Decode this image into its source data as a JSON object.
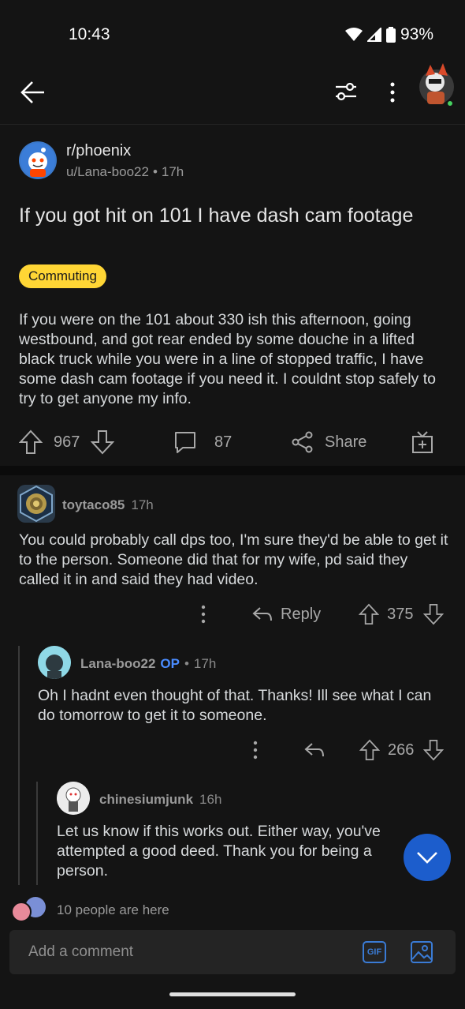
{
  "status_bar": {
    "time": "10:43",
    "battery": "93%"
  },
  "post": {
    "subreddit": "r/phoenix",
    "author": "u/Lana-boo22",
    "age": "17h",
    "title": "If you got hit on 101 I have dash cam footage",
    "flair": "Commuting",
    "body": "If you were on the 101 about 330 ish this afternoon, going westbound, and got rear ended by some douche in a lifted black truck while you were in a line of stopped traffic, I have some dash cam footage if you need it. I couldnt stop safely to try to get anyone my info.",
    "votes": "967",
    "comments": "87",
    "share_label": "Share"
  },
  "comments": [
    {
      "author": "toytaco85",
      "age": "17h",
      "text": "You could probably call dps too, I'm sure they'd be able to get it to the person. Someone did that for my wife, pd said they called it in and said they had video.",
      "reply_label": "Reply",
      "votes": "375"
    },
    {
      "author": "Lana-boo22",
      "op_badge": "OP",
      "age": "17h",
      "text": "Oh I hadnt even thought of that. Thanks! Ill see what I can do tomorrow to get it to someone.",
      "votes": "266"
    },
    {
      "author": "chinesiumjunk",
      "age": "16h",
      "text": "Let us know if this works out. Either way, you've attempted a good deed. Thank you for being a person."
    }
  ],
  "presence": {
    "text": "10 people are here"
  },
  "composer": {
    "placeholder": "Add a comment",
    "gif_label": "GIF"
  },
  "colors": {
    "background": "#141414",
    "flair": "#ffd635",
    "fab": "#1c5dcc",
    "op": "#4a8cff",
    "online": "#46d160"
  }
}
